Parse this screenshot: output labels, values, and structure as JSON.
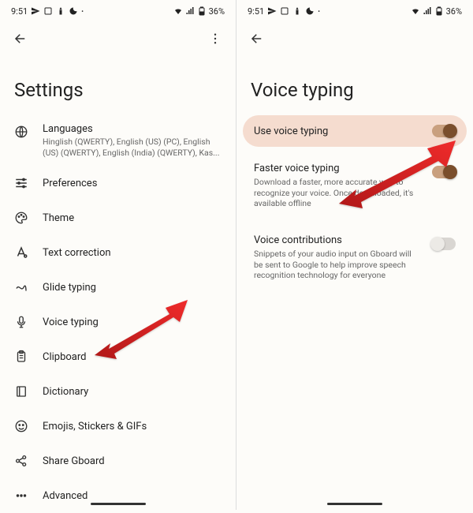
{
  "statusbar": {
    "time": "9:51",
    "battery": "36%"
  },
  "left": {
    "title": "Settings",
    "items": [
      {
        "label": "Languages",
        "sub": "Hinglish (QWERTY), English (US) (PC), English (US) (QWERTY), English (India) (QWERTY), Kas..."
      },
      {
        "label": "Preferences"
      },
      {
        "label": "Theme"
      },
      {
        "label": "Text correction"
      },
      {
        "label": "Glide typing"
      },
      {
        "label": "Voice typing"
      },
      {
        "label": "Clipboard"
      },
      {
        "label": "Dictionary"
      },
      {
        "label": "Emojis, Stickers & GIFs"
      },
      {
        "label": "Share Gboard"
      },
      {
        "label": "Advanced"
      }
    ]
  },
  "right": {
    "title": "Voice typing",
    "items": [
      {
        "label": "Use voice typing",
        "state": "on",
        "highlight": true
      },
      {
        "label": "Faster voice typing",
        "sub": "Download a faster, more accurate way to recognize your voice. Once downloaded, it's available offline",
        "state": "on"
      },
      {
        "label": "Voice contributions",
        "sub": "Snippets of your audio input on Gboard will be sent to Google to help improve speech recognition technology for everyone",
        "state": "off"
      }
    ]
  }
}
